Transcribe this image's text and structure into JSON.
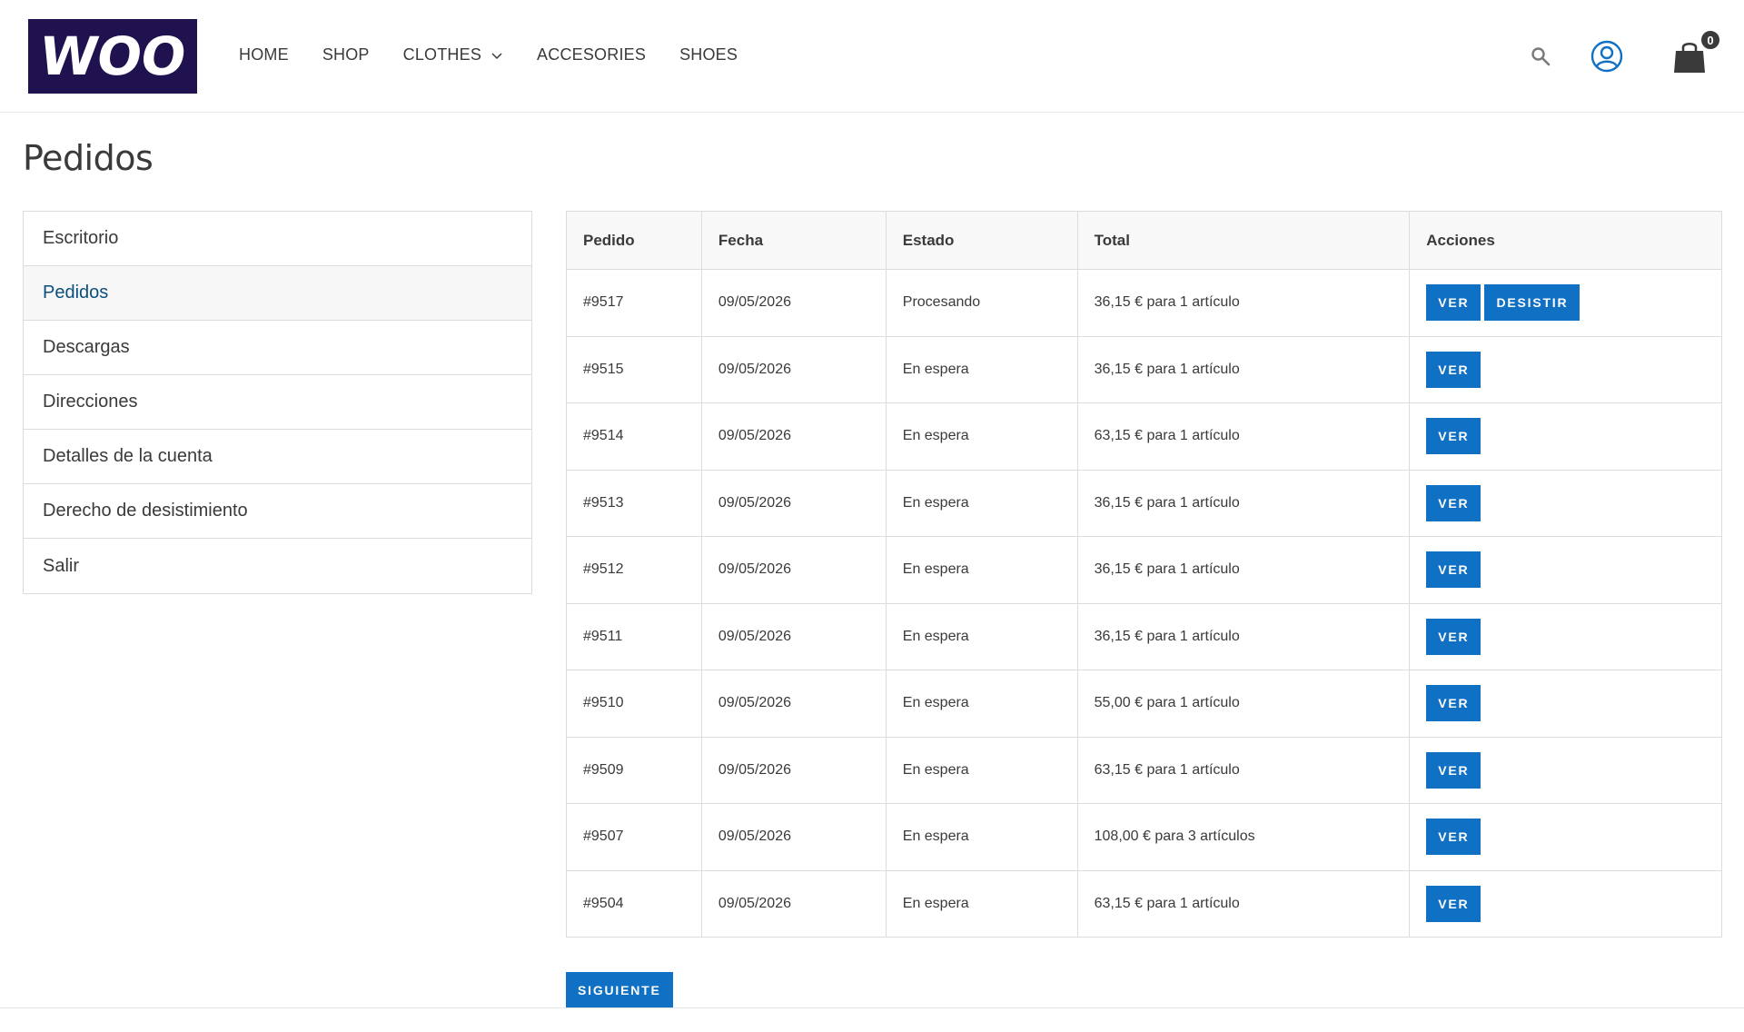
{
  "brand": {
    "logo_text": "WOO",
    "logo_color": "#20114f"
  },
  "nav": {
    "items": [
      {
        "label": "HOME"
      },
      {
        "label": "SHOP"
      },
      {
        "label": "CLOTHES",
        "has_dropdown": true
      },
      {
        "label": "ACCESORIES"
      },
      {
        "label": "SHOES"
      }
    ]
  },
  "header_icons": {
    "search": "search-icon",
    "account": "account-icon",
    "cart": "cart-icon",
    "cart_count": "0"
  },
  "page": {
    "title": "Pedidos"
  },
  "sidebar": {
    "items": [
      {
        "label": "Escritorio",
        "active": false
      },
      {
        "label": "Pedidos",
        "active": true
      },
      {
        "label": "Descargas",
        "active": false
      },
      {
        "label": "Direcciones",
        "active": false
      },
      {
        "label": "Detalles de la cuenta",
        "active": false
      },
      {
        "label": "Derecho de desistimiento",
        "active": false
      },
      {
        "label": "Salir",
        "active": false
      }
    ]
  },
  "orders": {
    "headers": [
      "Pedido",
      "Fecha",
      "Estado",
      "Total",
      "Acciones"
    ],
    "rows": [
      {
        "id": "#9517",
        "date": "09/05/2026",
        "status": "Procesando",
        "total": "36,15 € para 1 artículo",
        "actions": [
          "VER",
          "DESISTIR"
        ]
      },
      {
        "id": "#9515",
        "date": "09/05/2026",
        "status": "En espera",
        "total": "36,15 € para 1 artículo",
        "actions": [
          "VER"
        ]
      },
      {
        "id": "#9514",
        "date": "09/05/2026",
        "status": "En espera",
        "total": "63,15 € para 1 artículo",
        "actions": [
          "VER"
        ]
      },
      {
        "id": "#9513",
        "date": "09/05/2026",
        "status": "En espera",
        "total": "36,15 € para 1 artículo",
        "actions": [
          "VER"
        ]
      },
      {
        "id": "#9512",
        "date": "09/05/2026",
        "status": "En espera",
        "total": "36,15 € para 1 artículo",
        "actions": [
          "VER"
        ]
      },
      {
        "id": "#9511",
        "date": "09/05/2026",
        "status": "En espera",
        "total": "36,15 € para 1 artículo",
        "actions": [
          "VER"
        ]
      },
      {
        "id": "#9510",
        "date": "09/05/2026",
        "status": "En espera",
        "total": "55,00 € para 1 artículo",
        "actions": [
          "VER"
        ]
      },
      {
        "id": "#9509",
        "date": "09/05/2026",
        "status": "En espera",
        "total": "63,15 € para 1 artículo",
        "actions": [
          "VER"
        ]
      },
      {
        "id": "#9507",
        "date": "09/05/2026",
        "status": "En espera",
        "total": "108,00 € para 3 artículos",
        "actions": [
          "VER"
        ]
      },
      {
        "id": "#9504",
        "date": "09/05/2026",
        "status": "En espera",
        "total": "63,15 € para 1 artículo",
        "actions": [
          "VER"
        ]
      }
    ]
  },
  "pagination": {
    "next_label": "SIGUIENTE"
  },
  "colors": {
    "accent": "#0f70c4",
    "active_link": "#0a4f7e",
    "text": "#3a3a3a",
    "border": "#dcdcdc"
  }
}
